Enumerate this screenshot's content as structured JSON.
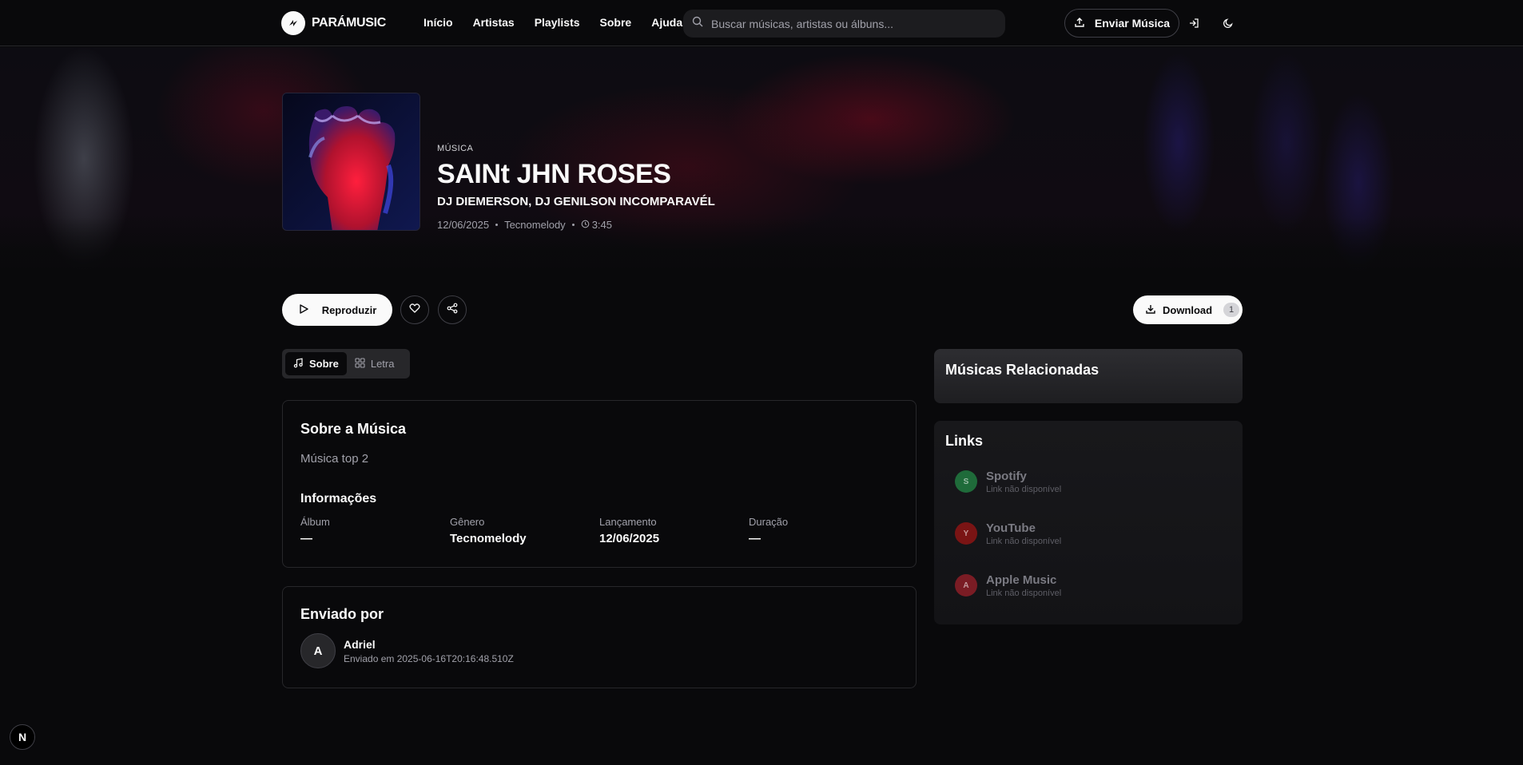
{
  "header": {
    "brand": "PARÁMUSIC",
    "nav": [
      "Início",
      "Artistas",
      "Playlists",
      "Sobre",
      "Ajuda"
    ],
    "search_placeholder": "Buscar músicas, artistas ou álbuns...",
    "upload_label": "Enviar Música",
    "icons": [
      "search-icon",
      "upload-icon",
      "login-icon",
      "moon-icon"
    ]
  },
  "song": {
    "type_label": "MÚSICA",
    "title": "SAINt JHN ROSES",
    "artists": "DJ DIEMERSON, DJ GENILSON INCOMPARAVÉL",
    "date": "12/06/2025",
    "genre": "Tecnomelody",
    "duration": "3:45"
  },
  "actions": {
    "play_label": "Reproduzir",
    "download_label": "Download",
    "download_count": "1"
  },
  "tabs": [
    {
      "label": "Sobre",
      "active": true
    },
    {
      "label": "Letra",
      "active": false
    }
  ],
  "about": {
    "title": "Sobre a Música",
    "description": "Música top 2",
    "info_title": "Informações",
    "fields": [
      {
        "label": "Álbum",
        "value": "—"
      },
      {
        "label": "Gênero",
        "value": "Tecnomelody"
      },
      {
        "label": "Lançamento",
        "value": "12/06/2025"
      },
      {
        "label": "Duração",
        "value": "—"
      }
    ]
  },
  "uploader": {
    "title": "Enviado por",
    "initial": "A",
    "name": "Adriel",
    "sent_at": "Enviado em 2025-06-16T20:16:48.510Z"
  },
  "related": {
    "title": "Músicas Relacionadas"
  },
  "links": {
    "title": "Links",
    "items": [
      {
        "initial": "S",
        "name": "Spotify",
        "status": "Link não disponível",
        "color": "#1f6b3a"
      },
      {
        "initial": "Y",
        "name": "YouTube",
        "status": "Link não disponível",
        "color": "#7a1414"
      },
      {
        "initial": "A",
        "name": "Apple Music",
        "status": "Link não disponível",
        "color": "#7a1c24"
      }
    ]
  },
  "dev_badge": "N"
}
